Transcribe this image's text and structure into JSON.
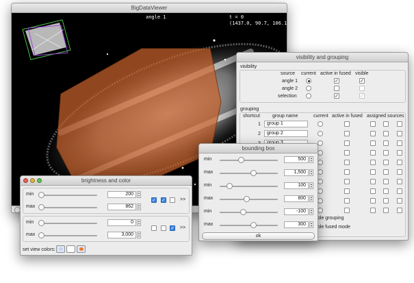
{
  "bdv": {
    "title": "BigDataViewer",
    "source_label": "angle 1",
    "timepoint": "t = 0",
    "coords": "(1437.0,  90.7, 106.1)"
  },
  "visibility_grouping": {
    "title": "visibility and grouping",
    "visibility_label": "visibility",
    "columns": {
      "source": "source",
      "current": "current",
      "active": "active in fused",
      "visible": "visible"
    },
    "sources": [
      {
        "name": "angle 1",
        "current": true,
        "active": true,
        "visible": true
      },
      {
        "name": "angle 2",
        "current": false,
        "active": false,
        "visible": false
      },
      {
        "name": "selection",
        "current": false,
        "active": true,
        "visible": true
      }
    ],
    "grouping_label": "grouping",
    "group_columns": {
      "shortcut": "shortcut",
      "group_name": "group name",
      "current": "current",
      "active": "active in fused",
      "assigned": "assigned sources"
    },
    "groups": [
      {
        "shortcut": "1",
        "name": "group 1"
      },
      {
        "shortcut": "2",
        "name": "group 2"
      },
      {
        "shortcut": "3",
        "name": "group 3"
      }
    ],
    "enable_grouping": "ble grouping",
    "enable_fused": "ble fused mode"
  },
  "bounding_box": {
    "title": "bounding box",
    "rows": [
      {
        "label": "min",
        "value": "500",
        "level": 0.36
      },
      {
        "label": "max",
        "value": "1,500",
        "level": 0.58
      },
      {
        "label": "min",
        "value": "100",
        "level": 0.17
      },
      {
        "label": "max",
        "value": "800",
        "level": 0.46
      },
      {
        "label": "min",
        "value": "-100",
        "level": 0.4
      },
      {
        "label": "max",
        "value": "300",
        "level": 0.58
      }
    ],
    "ok_label": "ok"
  },
  "brightness": {
    "title": "brightness and color",
    "rows": [
      {
        "label": "min",
        "value": "200",
        "level": 0.0
      },
      {
        "label": "max",
        "value": "862",
        "level": 0.0
      },
      {
        "label": "min",
        "value": "0",
        "level": 0.0
      },
      {
        "label": "max",
        "value": "3,000",
        "level": 0.0
      }
    ],
    "more_label_1": ">>",
    "more_label_2": ">>",
    "set_view_colors": "set view colors:",
    "colors": {
      "blue": "#c8d4f0",
      "white": "#ffffff",
      "orange": "#f07a22"
    }
  }
}
